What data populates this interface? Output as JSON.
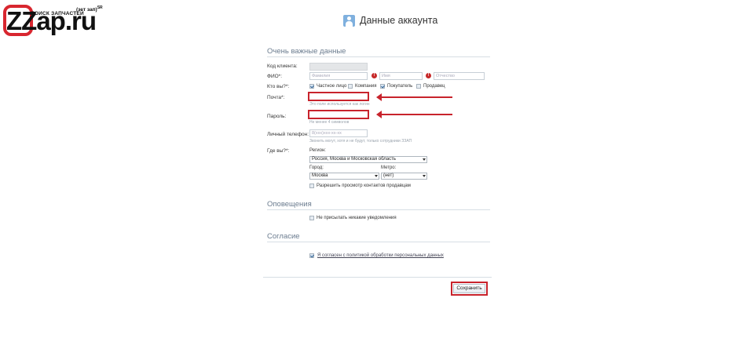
{
  "logo": {
    "text": "ZZap.ru",
    "subtitle": "ПОИСК ЗАПЧАСТЕЙ",
    "badge": "(зет зап)",
    "badge_sup": "SR"
  },
  "page_title": "Данные аккаунта",
  "sections": {
    "important": "Очень важные данные",
    "notifications": "Оповещения",
    "consent": "Согласие"
  },
  "form": {
    "client_code_label": "Код клиента:",
    "fio_label": "ФИО*:",
    "last_name_placeholder": "Фамилия",
    "first_name_placeholder": "Имя",
    "middle_name_placeholder": "Отчество",
    "who_label": "Кто вы?*:",
    "who_options": [
      "Частное лицо",
      "Компания",
      "Покупатель",
      "Продавец"
    ],
    "email_label": "Почта*:",
    "email_hint": "Это поле используется как логин",
    "password_label": "Пароль:",
    "password_hint": "Не менее 4 символов",
    "phone_label": "Личный телефон:",
    "phone_placeholder": "8(xxx)xxx-xx-xx",
    "phone_hint": "Звонить могут, хотя и не будут, только сотрудники ЗЗАП",
    "where_label": "Где вы?*:",
    "region_label": "Регион:",
    "region_value": "Россия, Москва и Московская область",
    "city_label": "Город:",
    "city_value": "Москва",
    "metro_label": "Метро:",
    "metro_value": "(нет)",
    "allow_contacts_label": "Разрешить просмотр контактов продавцам",
    "no_notifications_label": "Не присылать никакие уведомления",
    "consent_label": "Я согласен с политикой обработки персональных данных",
    "save_label": "Сохранить"
  },
  "colors": {
    "highlight": "#c8232c",
    "section_heading": "#6b7c8f",
    "logo_red": "#d8262f"
  }
}
